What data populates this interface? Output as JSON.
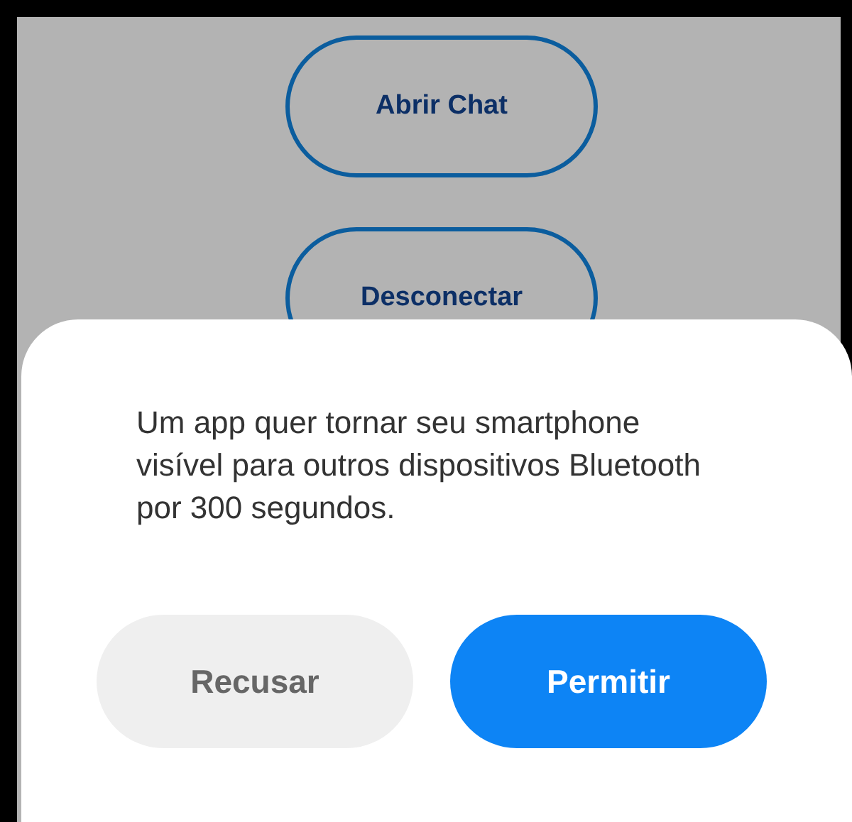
{
  "screen": {
    "buttons": [
      {
        "label": "Abrir Chat"
      },
      {
        "label": "Desconectar"
      }
    ]
  },
  "dialog": {
    "message": "Um app quer tornar seu smartphone visível para outros dispositivos Bluetooth por 300 segundos.",
    "buttons": [
      {
        "label": "Recusar",
        "kind": "secondary"
      },
      {
        "label": "Permitir",
        "kind": "primary"
      }
    ]
  }
}
